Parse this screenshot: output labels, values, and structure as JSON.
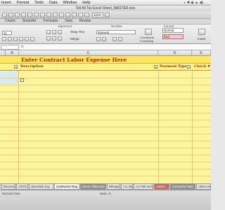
{
  "menubar": {
    "items": [
      "Insert",
      "Format",
      "Tools",
      "Data",
      "Window",
      "Help"
    ]
  },
  "window": {
    "title": "Tell All Tax Excel Sheet_MASTER.xlsx",
    "zoom": "115%"
  },
  "ribbon": {
    "tabs": [
      "Charts",
      "SmartArt",
      "Formulas",
      "Data",
      "Review"
    ],
    "groups": {
      "alignment": "Alignment",
      "number": "Number",
      "format": "Format"
    },
    "font_size": "11",
    "wrap_text": "Wrap Text",
    "number_format": "General",
    "merge": "Merge",
    "conditional_formatting": "Conditional Formatting",
    "style_normal": "Normal",
    "style_bad": "Bad",
    "insert": "Insert"
  },
  "grid": {
    "columns": [
      "A",
      "B",
      "C",
      "D",
      "E"
    ],
    "title": "Enter Contract Labor Expense Here",
    "headers": {
      "description": "Description",
      "payment_type": "Payment Type",
      "check": "Check #"
    }
  },
  "sheet_tabs": [
    "Revenue",
    "COGS",
    "Operation Exp",
    "Contractor Exp",
    "Home Office Exp",
    "Mileage",
    "Acc Bal",
    "Acc Wk Sum",
    "Assets",
    "Contractor Data",
    "Client List"
  ],
  "active_tab_index": 3,
  "status": {
    "view": "Normal View",
    "sum": "Sum= 0"
  }
}
